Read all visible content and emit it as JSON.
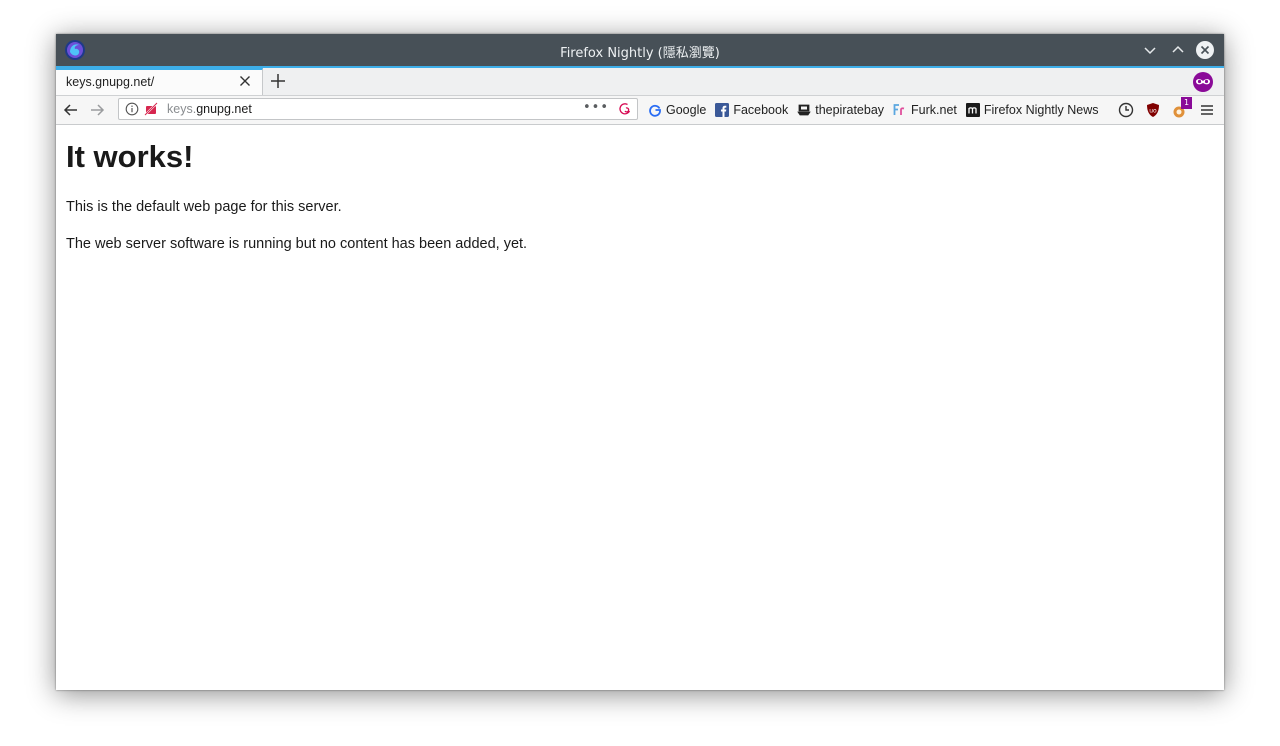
{
  "window": {
    "title": "Firefox Nightly (隱私瀏覽)"
  },
  "tabs": [
    {
      "title": "keys.gnupg.net/"
    }
  ],
  "urlbar": {
    "url_subdomain": "keys.",
    "url_domain": "gnupg.net",
    "page_actions_label": "•••"
  },
  "bookmarks": [
    {
      "label": "Google",
      "icon": "google-icon"
    },
    {
      "label": "Facebook",
      "icon": "facebook-icon"
    },
    {
      "label": "thepiratebay",
      "icon": "pirate-ship-icon"
    },
    {
      "label": "Furk.net",
      "icon": "furk-icon"
    },
    {
      "label": "Firefox Nightly News",
      "icon": "nightly-news-icon"
    }
  ],
  "toolbar": {
    "extension_badge_count": "1"
  },
  "page": {
    "heading": "It works!",
    "paragraph1": "This is the default web page for this server.",
    "paragraph2": "The web server software is running but no content has been added, yet."
  },
  "colors": {
    "titlebar": "#475057",
    "accent": "#3daee9",
    "private_purple": "#8a0a98"
  }
}
